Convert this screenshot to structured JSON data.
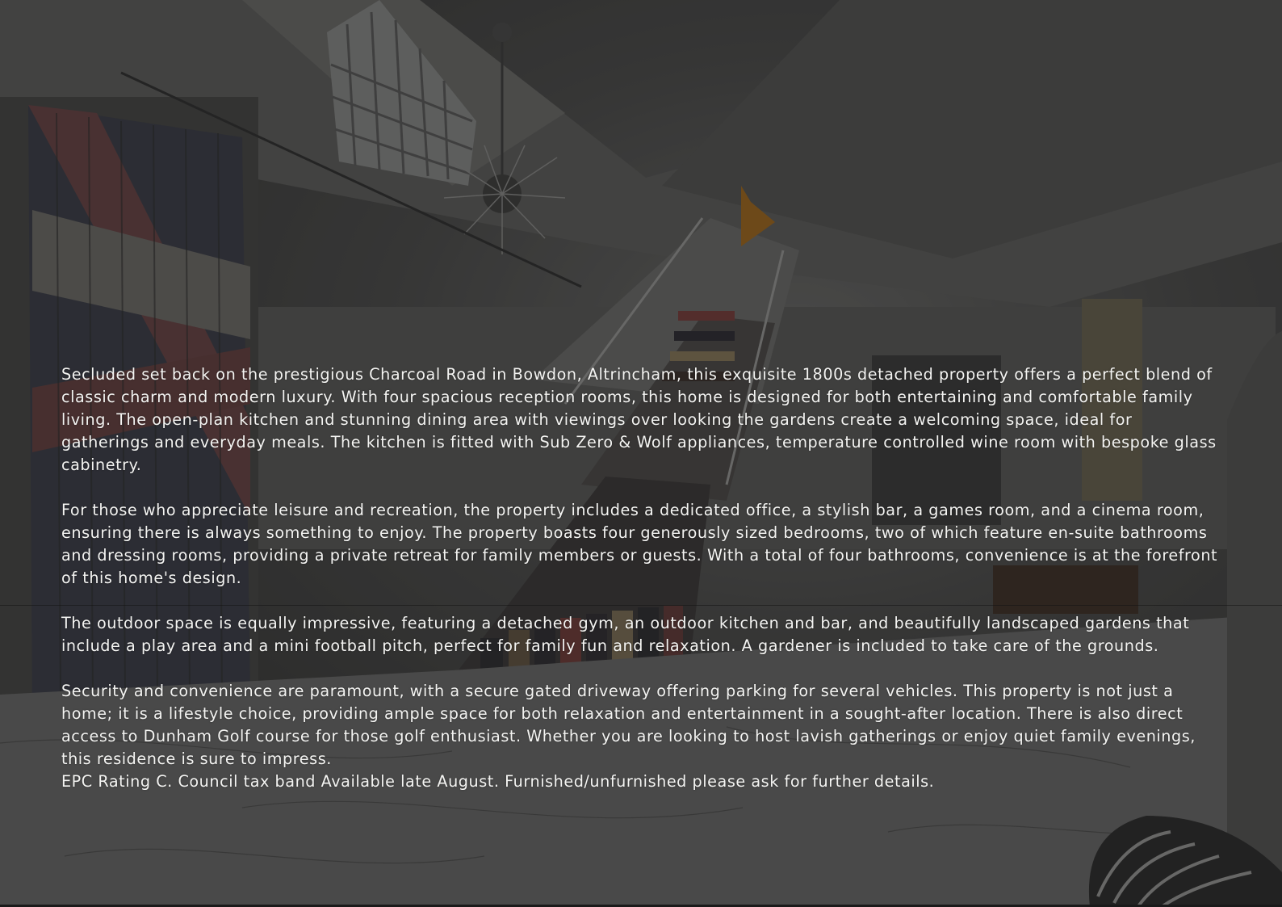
{
  "brochure": {
    "paragraphs": [
      "Secluded set back on the prestigious Charcoal Road in Bowdon, Altrincham, this exquisite 1800s detached property offers a perfect blend of classic charm and modern luxury. With four spacious reception rooms, this home is designed for both entertaining and comfortable family living. The open-plan kitchen and stunning dining area with viewings over looking the gardens create a welcoming space, ideal for gatherings and everyday meals. The kitchen is fitted with Sub Zero & Wolf appliances, temperature controlled wine room with bespoke glass cabinetry.",
      "For those who appreciate leisure and recreation, the property includes a dedicated office, a stylish bar, a games room, and a cinema room, ensuring there is always something to enjoy. The property boasts four generously sized bedrooms, two of which feature en-suite bathrooms and dressing rooms, providing a private retreat for family members or guests. With a total of four bathrooms, convenience is at the forefront of this home's design.",
      "The outdoor space is equally impressive, featuring a detached gym, an outdoor kitchen and bar, and beautifully landscaped gardens that include a play area and a mini football pitch, perfect for family fun and relaxation. A gardener is included to take care of the grounds.",
      "Security and convenience are paramount, with a secure gated driveway offering parking for several vehicles. This property is not just a home; it is a lifestyle choice, providing ample space for both relaxation and entertainment in a sought-after location. There is also direct access to Dunham Golf course for those golf enthusiast. Whether you are looking to host lavish gatherings or enjoy quiet family evenings, this residence is sure to impress.",
      "EPC Rating C. Council tax band Available late August. Furnished/unfurnished please ask for further details."
    ]
  }
}
